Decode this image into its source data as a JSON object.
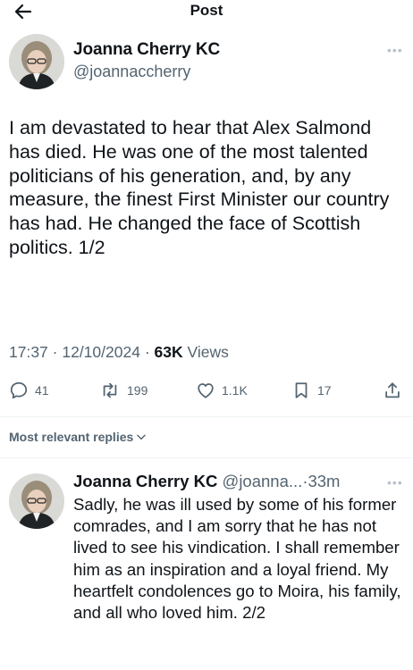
{
  "header": {
    "title": "Post"
  },
  "tweet": {
    "author_name": "Joanna Cherry KC",
    "author_handle": "@joannaccherry",
    "text": "I am devastated to hear that Alex Salmond has died. He was one of the most talented politicians of his generation, and, by any measure, the finest First Minister our country has had. He changed the face of Scottish politics. 1/2",
    "time": "17:37",
    "date": "12/10/2024",
    "views_count": "63K",
    "views_label": "Views",
    "actions": {
      "replies": "41",
      "reposts": "199",
      "likes": "1.1K",
      "bookmarks": "17"
    }
  },
  "replies_sort": {
    "label": "Most relevant replies"
  },
  "reply": {
    "author_name": "Joanna Cherry KC",
    "author_handle": "@joanna...",
    "time": "33m",
    "text": "Sadly, he was ill used by some of his former comrades, and I am sorry that he has not lived to see his vindication. I shall remember him as an inspiration and a loyal friend. My heartfelt condolences go to Moira, his family, and all who loved him. 2/2"
  },
  "icons": {
    "back": "arrow-left-icon",
    "more": "more-dots-icon",
    "reply": "reply-bubble-icon",
    "repost": "repost-icon",
    "like": "heart-icon",
    "bookmark": "bookmark-icon",
    "share": "share-icon",
    "chevron": "chevron-down-icon"
  },
  "colors": {
    "text": "#0f1419",
    "secondary": "#536471",
    "divider": "#eff3f4"
  }
}
